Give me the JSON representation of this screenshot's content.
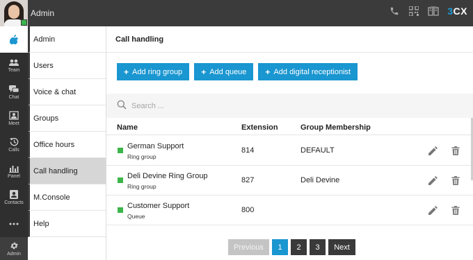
{
  "header": {
    "title": "Admin",
    "brand_prefix": "3",
    "brand_suffix": "CX",
    "icons": [
      "phone-icon",
      "qr-code-icon",
      "book-icon"
    ]
  },
  "rail": {
    "items": [
      {
        "label": "Team",
        "icon": "team-icon"
      },
      {
        "label": "Chat",
        "icon": "chat-icon"
      },
      {
        "label": "Meet",
        "icon": "meet-icon"
      },
      {
        "label": "Calls",
        "icon": "calls-icon"
      },
      {
        "label": "Panel",
        "icon": "panel-icon"
      },
      {
        "label": "Contacts",
        "icon": "contacts-icon"
      },
      {
        "label": "",
        "icon": "more-icon"
      },
      {
        "label": "Admin",
        "icon": "gear-icon"
      }
    ]
  },
  "submenu": {
    "items": [
      "Admin",
      "Users",
      "Voice & chat",
      "Groups",
      "Office hours",
      "Call handling",
      "M.Console",
      "Help"
    ],
    "active": "Call handling"
  },
  "page": {
    "title": "Call handling",
    "buttons": {
      "add_ring_group": "Add ring group",
      "add_queue": "Add queue",
      "add_digital_receptionist": "Add digital receptionist"
    },
    "search_placeholder": "Search ..."
  },
  "table": {
    "headers": {
      "name": "Name",
      "extension": "Extension",
      "group": "Group Membership"
    },
    "rows": [
      {
        "name": "German Support",
        "type": "Ring group",
        "extension": "814",
        "group": "DEFAULT",
        "status_color": "#3db54a"
      },
      {
        "name": "Deli Devine Ring Group",
        "type": "Ring group",
        "extension": "827",
        "group": "Deli Devine",
        "status_color": "#3db54a"
      },
      {
        "name": "Customer Support",
        "type": "Queue",
        "extension": "800",
        "group": "",
        "status_color": "#3db54a"
      }
    ]
  },
  "pagination": {
    "previous": "Previous",
    "pages": [
      "1",
      "2",
      "3"
    ],
    "current": "1",
    "next": "Next"
  },
  "colors": {
    "accent": "#1a96d1",
    "status_online": "#38b64a"
  }
}
